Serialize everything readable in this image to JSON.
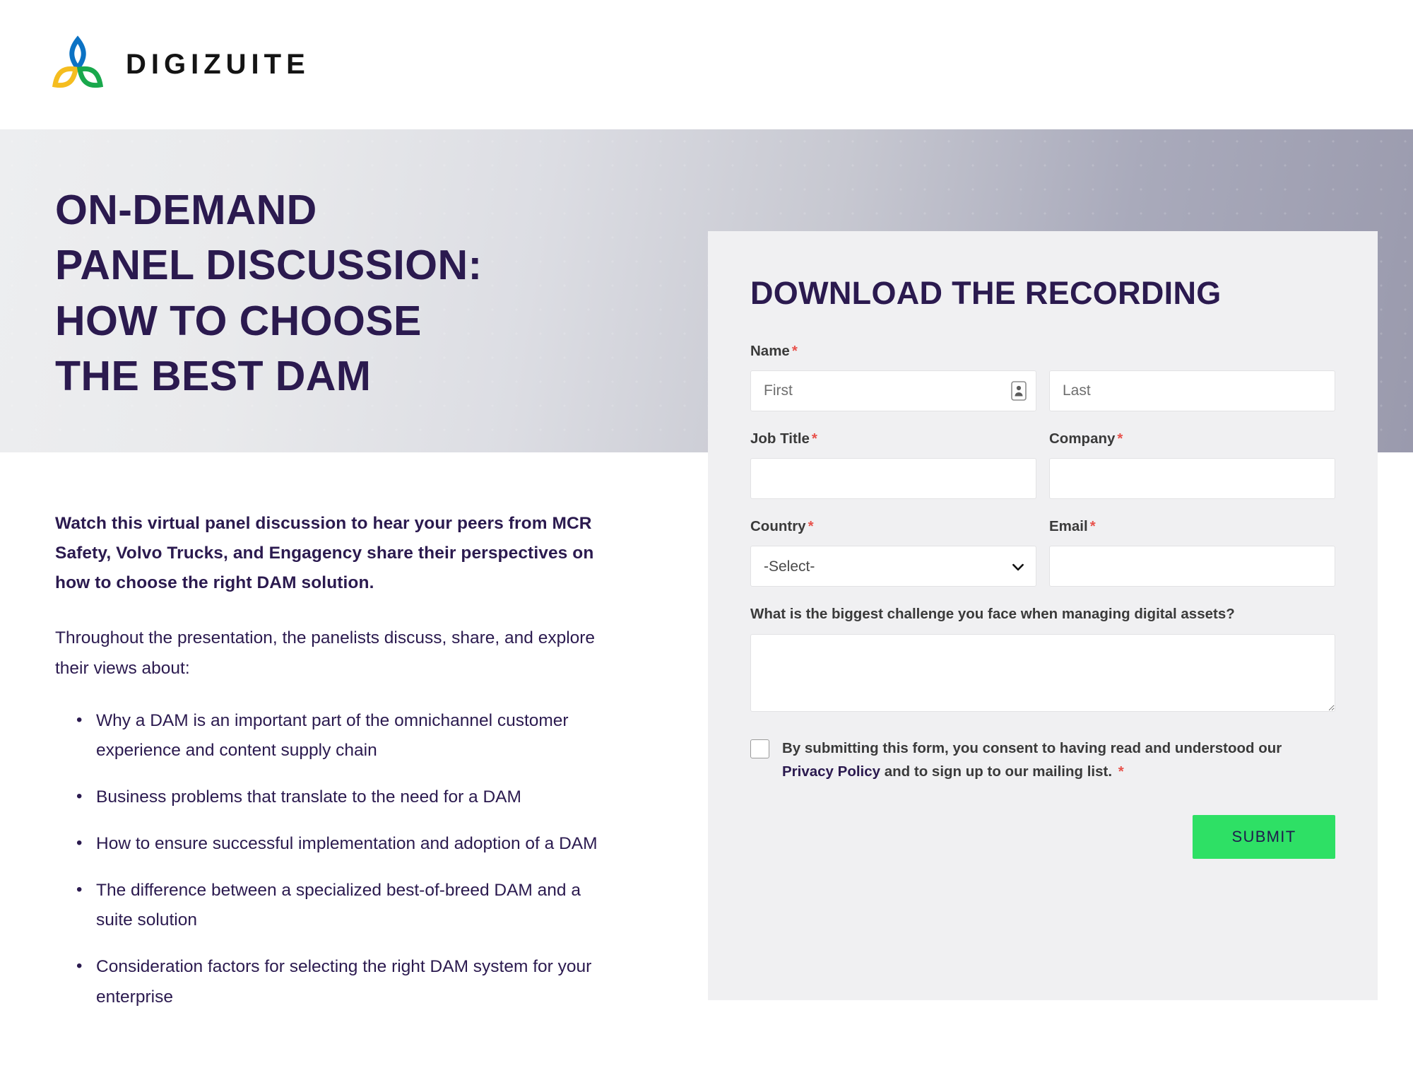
{
  "brand": {
    "name": "DIGIZUITE",
    "logo_colors": {
      "blue": "#0b72c4",
      "yellow": "#f5bd1f",
      "green": "#19a84c"
    },
    "heading_color": "#2b1a4f",
    "accent_green": "#2ee065",
    "required_red": "#e8524c"
  },
  "hero": {
    "title_lines": [
      "ON-DEMAND",
      "PANEL DISCUSSION:",
      "HOW TO CHOOSE",
      "THE BEST DAM"
    ]
  },
  "content": {
    "lead": "Watch this virtual panel discussion to hear your peers from MCR Safety, Volvo Trucks, and Engagency share their perspectives on how to choose the right DAM solution.",
    "paragraph": "Throughout the presentation, the panelists discuss, share, and explore their views about:",
    "bullets": [
      "Why a DAM is an important part of the omnichannel customer experience and content supply chain",
      "Business problems that translate to the need for a DAM",
      "How to ensure successful implementation and adoption of a DAM",
      "The difference between a specialized best-of-breed DAM and a suite solution",
      "Consideration factors for selecting the right DAM system for your enterprise"
    ]
  },
  "form": {
    "title": "DOWNLOAD THE RECORDING",
    "name": {
      "label": "Name",
      "required": "*",
      "first_placeholder": "First",
      "first_value": "",
      "last_placeholder": "Last",
      "last_value": ""
    },
    "job_title": {
      "label": "Job Title",
      "required": "*",
      "value": "",
      "placeholder": ""
    },
    "company": {
      "label": "Company",
      "required": "*",
      "value": "",
      "placeholder": ""
    },
    "country": {
      "label": "Country",
      "required": "*",
      "selected": "-Select-",
      "options": [
        "-Select-"
      ]
    },
    "email": {
      "label": "Email",
      "required": "*",
      "value": "",
      "placeholder": ""
    },
    "challenge": {
      "label": "What is the biggest challenge you face when managing digital assets?",
      "value": "",
      "placeholder": ""
    },
    "consent": {
      "text_before": "By submitting this form, you consent to having read and understood our ",
      "link_text": "Privacy Policy",
      "text_after": " and to sign up to our mailing list.",
      "required": "*",
      "checked": false
    },
    "submit_label": "SUBMIT"
  }
}
